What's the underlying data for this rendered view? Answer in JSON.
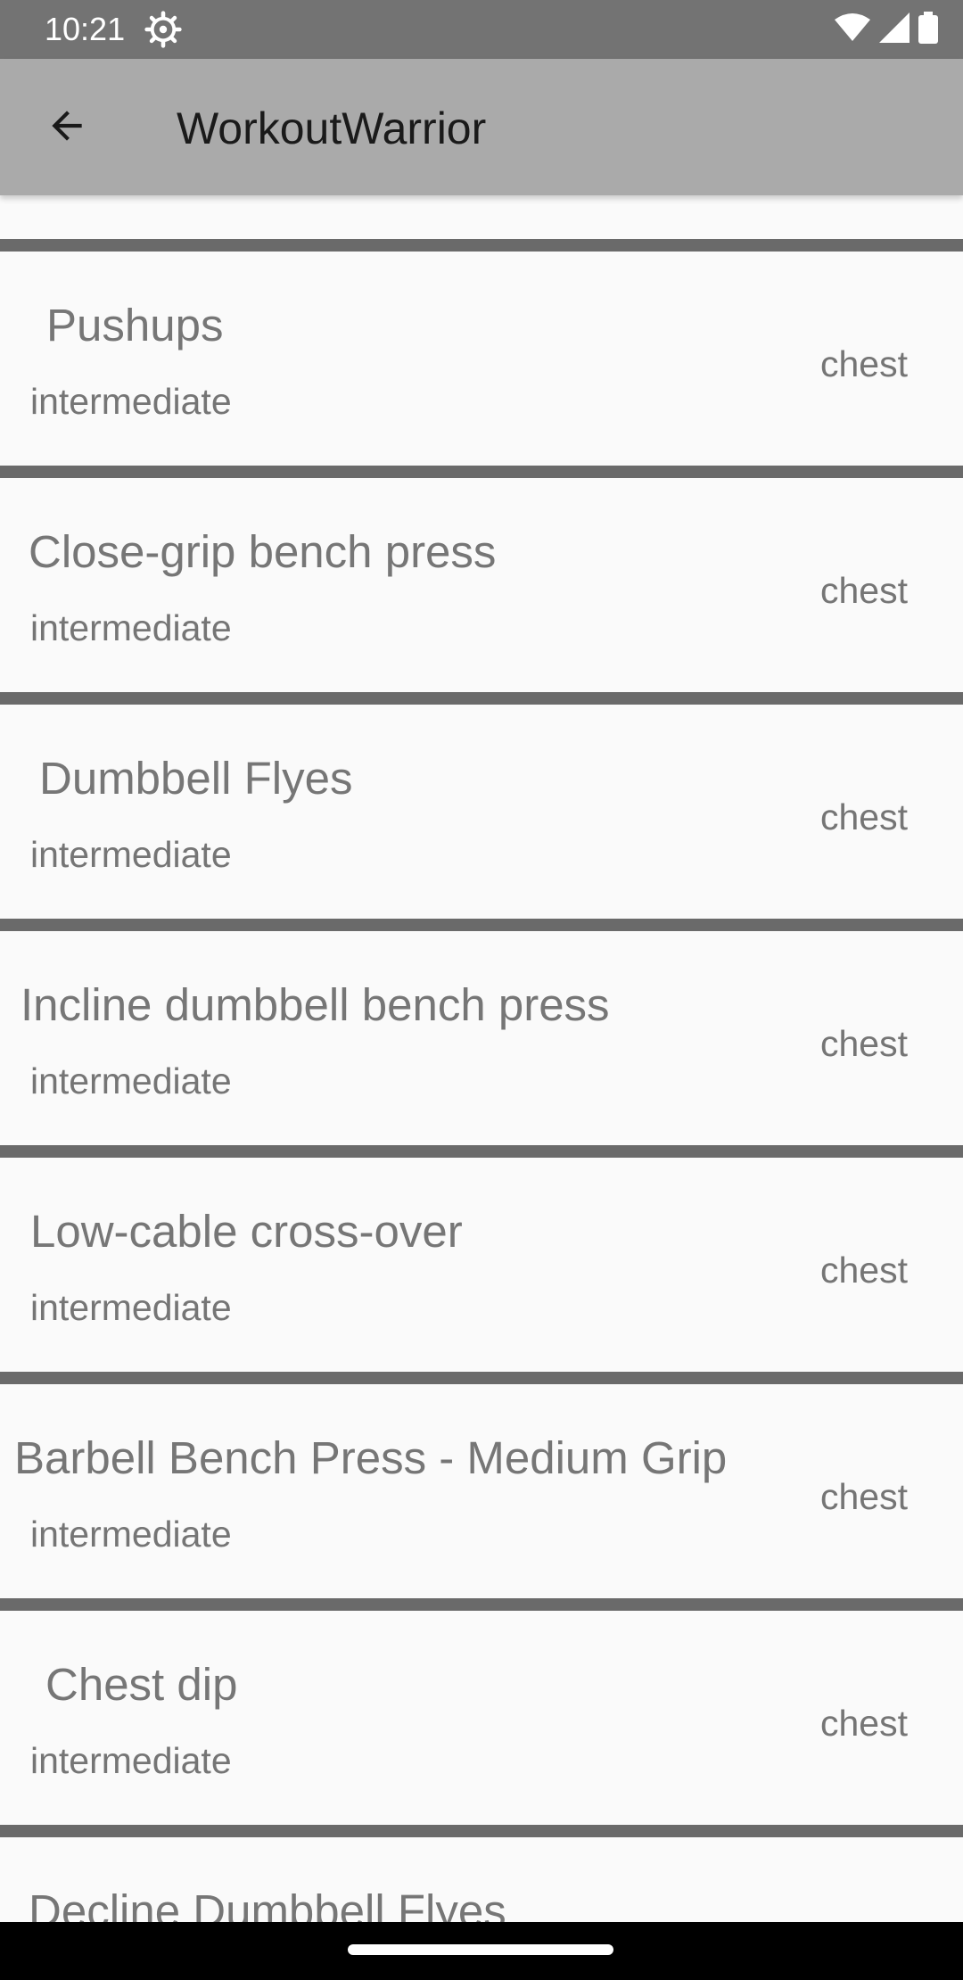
{
  "status_bar": {
    "time": "10:21",
    "icons": [
      "settings-gear-icon",
      "wifi-icon",
      "signal-icon",
      "battery-icon"
    ]
  },
  "app_bar": {
    "title": "WorkoutWarrior",
    "back_icon": "arrow-back-icon"
  },
  "exercises": [
    {
      "name": "Pushups",
      "level": "intermediate",
      "muscle": "chest"
    },
    {
      "name": "Close-grip bench press",
      "level": "intermediate",
      "muscle": "chest"
    },
    {
      "name": "Dumbbell Flyes",
      "level": "intermediate",
      "muscle": "chest"
    },
    {
      "name": "Incline dumbbell bench press",
      "level": "intermediate",
      "muscle": "chest"
    },
    {
      "name": "Low-cable cross-over",
      "level": "intermediate",
      "muscle": "chest"
    },
    {
      "name": "Barbell Bench Press - Medium Grip",
      "level": "intermediate",
      "muscle": "chest"
    },
    {
      "name": "Chest dip",
      "level": "intermediate",
      "muscle": "chest"
    },
    {
      "name": "Decline Dumbbell Flyes",
      "level": "",
      "muscle": ""
    }
  ],
  "colors": {
    "app_bar": "#aaaaaa",
    "status_bar": "#737373",
    "divider": "#6a6a6a",
    "background": "#fafafa"
  }
}
